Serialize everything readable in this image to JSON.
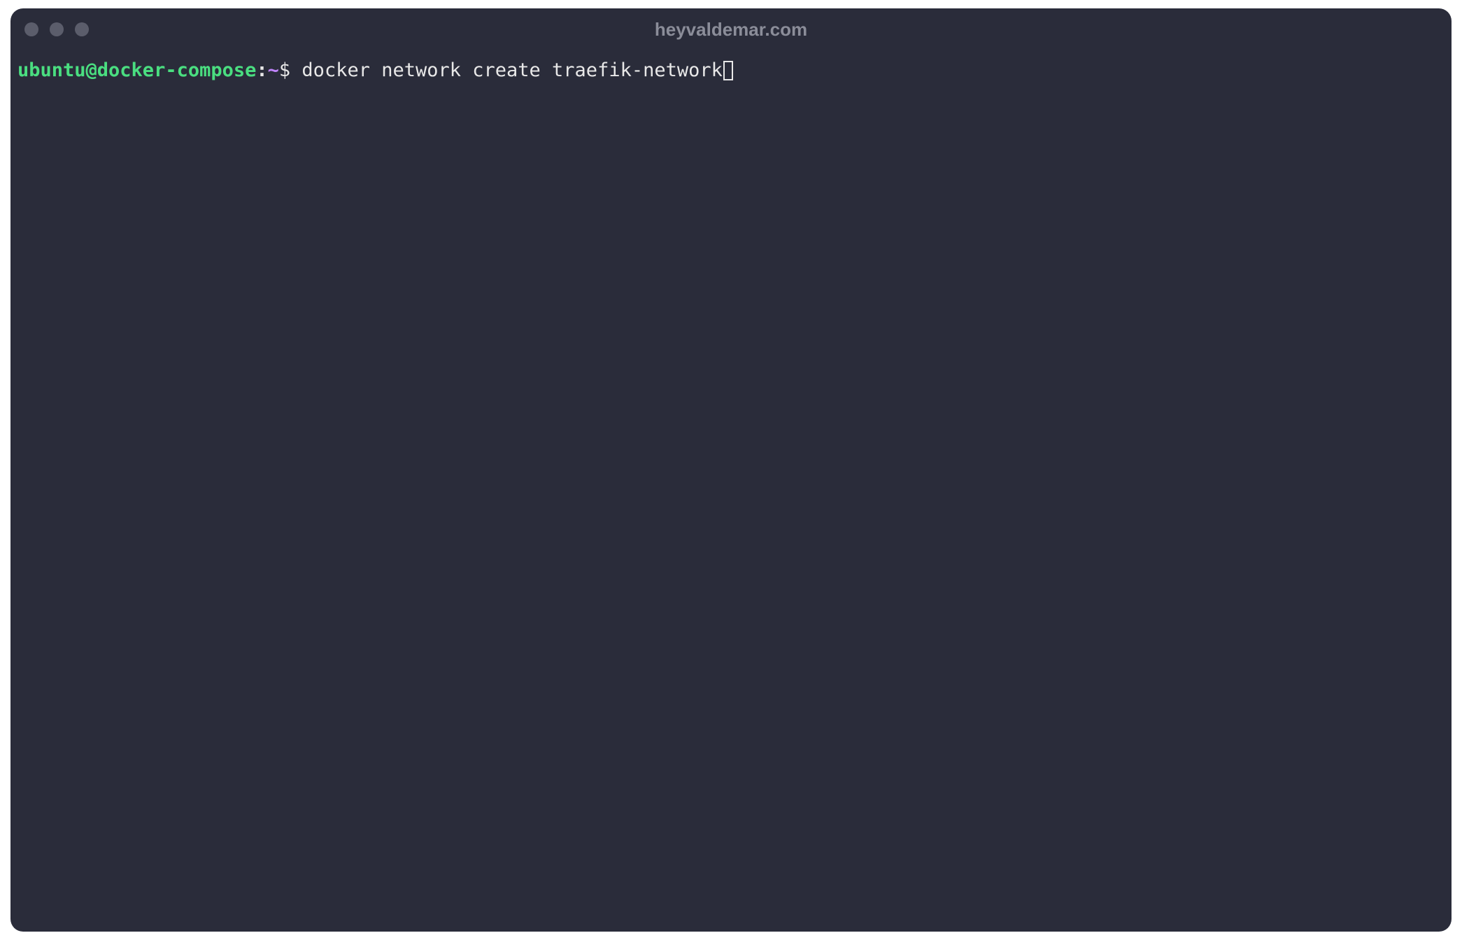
{
  "window": {
    "title": "heyvaldemar.com"
  },
  "terminal": {
    "prompt": {
      "user_host": "ubuntu@docker-compose",
      "colon": ":",
      "path": "~",
      "symbol": "$"
    },
    "command": " docker network create traefik-network"
  },
  "colors": {
    "background": "#2a2c3a",
    "prompt_user_host": "#4ade80",
    "prompt_path": "#c084fc",
    "text": "#e8e8e8",
    "title": "#8b8d99",
    "traffic_light": "#5b5d6b"
  }
}
